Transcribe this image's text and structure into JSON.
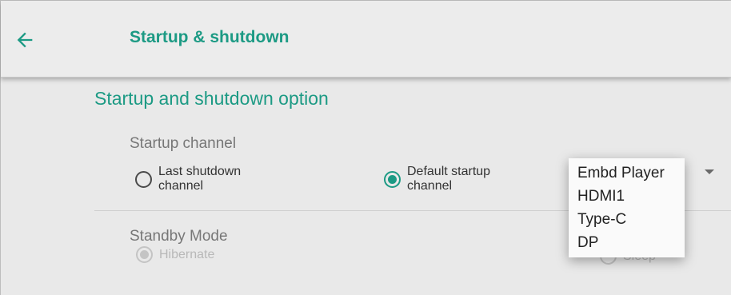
{
  "header": {
    "back_icon": "arrow-left-icon",
    "title": "Startup & shutdown"
  },
  "section": {
    "title": "Startup and shutdown option"
  },
  "startup_channel": {
    "label": "Startup channel",
    "options": [
      {
        "label": "Last shutdown channel",
        "checked": false
      },
      {
        "label": "Default startup channel",
        "checked": true
      }
    ],
    "dropdown": {
      "options": [
        "Embd Player",
        "HDMI1",
        "Type-C",
        "DP"
      ],
      "expanded": true
    }
  },
  "standby_mode": {
    "label": "Standby Mode",
    "options": [
      {
        "label": "Hibernate",
        "checked": true,
        "disabled": true
      },
      {
        "label": "Sleep",
        "checked": false,
        "disabled": true
      }
    ]
  },
  "colors": {
    "accent": "#1c9a84",
    "background": "#e9e9e9"
  }
}
